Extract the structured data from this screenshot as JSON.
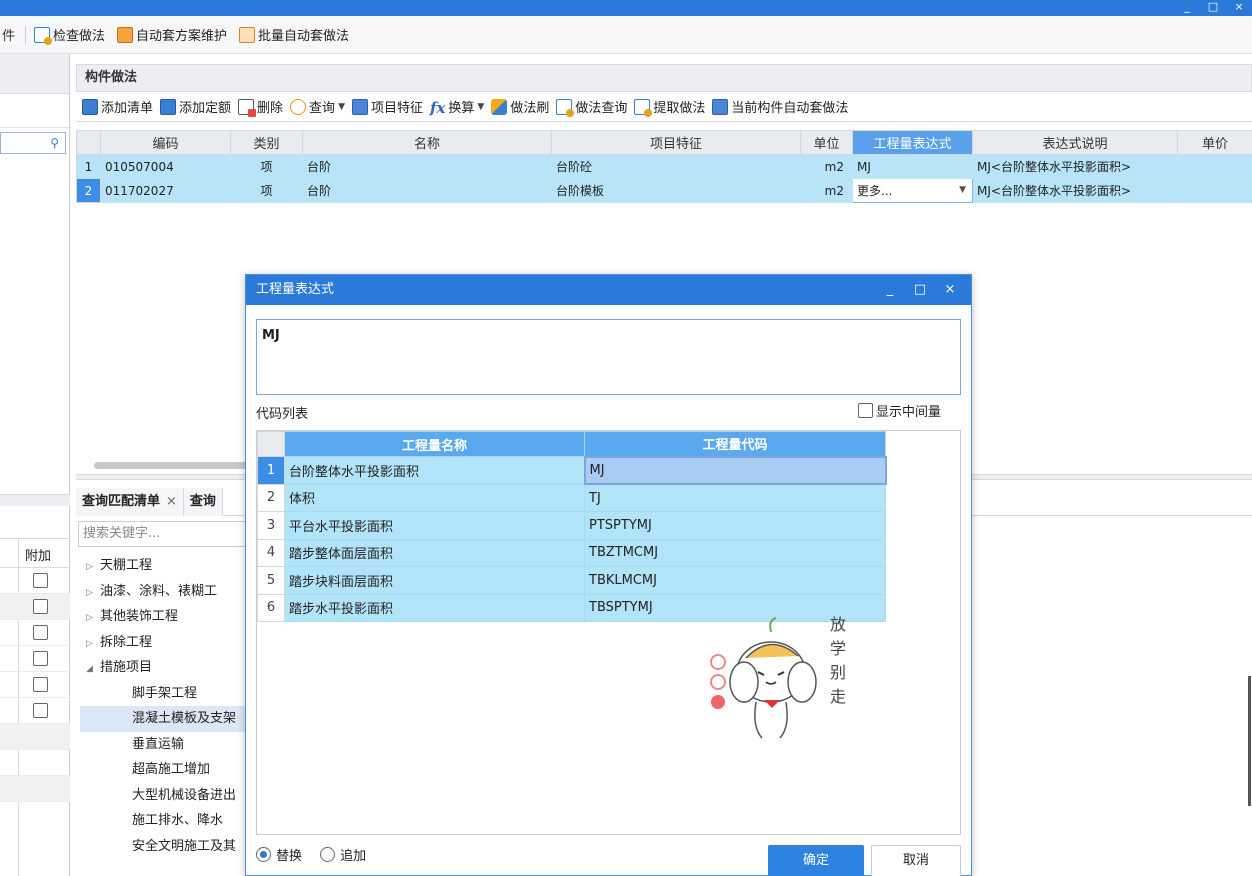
{
  "main_toolbar": {
    "cut_fragment": "件",
    "items": [
      {
        "label": "检查做法",
        "icon": "check-method-icon"
      },
      {
        "label": "自动套方案维护",
        "icon": "auto-scheme-icon"
      },
      {
        "label": "批量自动套做法",
        "icon": "batch-auto-icon"
      }
    ]
  },
  "component_method": {
    "panel_title": "构件做法",
    "toolbar": {
      "add_list": "添加清单",
      "add_quota": "添加定额",
      "delete": "删除",
      "query": "查询",
      "item_feature": "项目特征",
      "convert": "换算",
      "method_brush": "做法刷",
      "method_query": "做法查询",
      "extract_method": "提取做法",
      "auto_apply_current": "当前构件自动套做法"
    },
    "columns": [
      "编码",
      "类别",
      "名称",
      "项目特征",
      "单位",
      "工程量表达式",
      "表达式说明",
      "单价"
    ],
    "rows": [
      {
        "num": "1",
        "code": "010507004",
        "type": "项",
        "name": "台阶",
        "feature": "台阶砼",
        "unit": "m2",
        "expr": "MJ",
        "desc": "MJ<台阶整体水平投影面积>",
        "price": ""
      },
      {
        "num": "2",
        "code": "011702027",
        "type": "项",
        "name": "台阶",
        "feature": "台阶模板",
        "unit": "m2",
        "expr": "更多...",
        "desc": "MJ<台阶整体水平投影面积>",
        "price": ""
      }
    ]
  },
  "lower": {
    "tabs": [
      {
        "label": "查询匹配清单",
        "close": "×"
      },
      {
        "label": "查询",
        "close": ""
      }
    ],
    "search_placeholder": "搜索关键字...",
    "tree": [
      {
        "label": "天棚工程",
        "arrow": "▷",
        "child": false
      },
      {
        "label": "油漆、涂料、裱糊工",
        "arrow": "▷",
        "child": false
      },
      {
        "label": "其他装饰工程",
        "arrow": "▷",
        "child": false
      },
      {
        "label": "拆除工程",
        "arrow": "▷",
        "child": false
      },
      {
        "label": "措施项目",
        "arrow": "◢",
        "child": false
      },
      {
        "label": "脚手架工程",
        "arrow": "",
        "child": true
      },
      {
        "label": "混凝土模板及支架",
        "arrow": "",
        "child": true
      },
      {
        "label": "垂直运输",
        "arrow": "",
        "child": true
      },
      {
        "label": "超高施工增加",
        "arrow": "",
        "child": true
      },
      {
        "label": "大型机械设备进出",
        "arrow": "",
        "child": true
      },
      {
        "label": "施工排水、降水",
        "arrow": "",
        "child": true
      },
      {
        "label": "安全文明施工及其",
        "arrow": "",
        "child": true
      }
    ]
  },
  "left": {
    "attach_header": "附加",
    "checkbox_count": 6
  },
  "dialog": {
    "title": "工程量表达式",
    "expression": "MJ",
    "code_list_label": "代码列表",
    "show_intermediate": "显示中间量",
    "columns": [
      "工程量名称",
      "工程量代码"
    ],
    "rows": [
      {
        "num": "1",
        "name": "台阶整体水平投影面积",
        "code": "MJ"
      },
      {
        "num": "2",
        "name": "体积",
        "code": "TJ"
      },
      {
        "num": "3",
        "name": "平台水平投影面积",
        "code": "PTSPTYMJ"
      },
      {
        "num": "4",
        "name": "踏步整体面层面积",
        "code": "TBZTMCMJ"
      },
      {
        "num": "5",
        "name": "踏步块料面层面积",
        "code": "TBKLMCMJ"
      },
      {
        "num": "6",
        "name": "踏步水平投影面积",
        "code": "TBSPTYMJ"
      }
    ],
    "sticker_text": [
      "放",
      "学",
      "别",
      "走"
    ],
    "radio_replace": "替换",
    "radio_append": "追加",
    "ok": "确定",
    "cancel": "取消",
    "win_min": "_",
    "win_max": "□",
    "win_close": "×"
  },
  "window_controls": [
    "_",
    "□",
    "×"
  ],
  "colors": {
    "title_bar": "#2b79d9",
    "selected_row": "#b7e4f8",
    "active_header": "#5aa0ea",
    "ok_button": "#2f83e0"
  }
}
